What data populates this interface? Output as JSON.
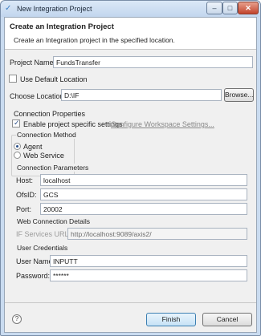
{
  "window": {
    "title": "New Integration Project",
    "min_glyph": "–",
    "max_glyph": "□",
    "close_glyph": "✕"
  },
  "banner": {
    "title": "Create an Integration Project",
    "description": "Create an Integration project in the specified location."
  },
  "project": {
    "name_label": "Project Name:",
    "name_value": "FundsTransfer",
    "use_default_label": "Use Default Location",
    "use_default_checked": false,
    "location_label": "Choose Location:",
    "location_value": "D:\\IF",
    "browse_label": "Browse..."
  },
  "connection_properties": {
    "title": "Connection Properties",
    "enable_label": "Enable project specific settings",
    "enable_checked": true,
    "configure_link": "Configure Workspace Settings..."
  },
  "connection_method": {
    "title": "Connection Method",
    "options": [
      "Agent",
      "Web Service"
    ],
    "selected": "Agent"
  },
  "connection_parameters": {
    "title": "Connection Parameters",
    "host_label": "Host:",
    "host_value": "localhost",
    "ofsid_label": "OfsID:",
    "ofsid_value": "GCS",
    "port_label": "Port:",
    "port_value": "20002"
  },
  "web_connection": {
    "title": "Web Connection Details",
    "url_label": "IF Services URL :",
    "url_value": "http://localhost:9089/axis2/"
  },
  "credentials": {
    "title": "User Credentials",
    "username_label": "User Name:",
    "username_value": "INPUTT",
    "password_label": "Password:",
    "password_value": "******"
  },
  "footer": {
    "help_glyph": "?",
    "finish_label": "Finish",
    "cancel_label": "Cancel"
  }
}
